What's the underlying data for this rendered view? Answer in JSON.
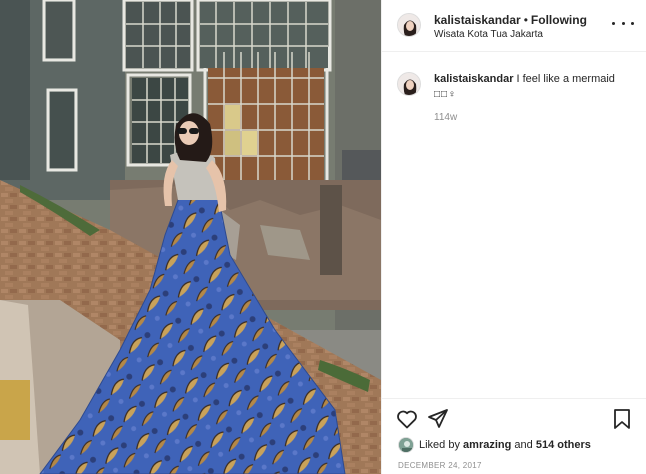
{
  "post": {
    "username": "kalistaiskandar",
    "separator": "•",
    "follow_label": "Following",
    "location": "Wisata Kota Tua Jakarta"
  },
  "caption": {
    "username": "kalistaiskandar",
    "text": "I feel like a mermaid",
    "emoji": "□□♀",
    "time": "114w"
  },
  "likes": {
    "prefix": "Liked by",
    "user": "amrazing",
    "connector": "and",
    "others": "514 others"
  },
  "date": "DECEMBER 24, 2017",
  "icons": {
    "more": "more-options-icon",
    "like": "heart-icon",
    "share": "share-icon",
    "save": "bookmark-icon"
  },
  "colors": {
    "text": "#262626",
    "muted": "#8e8e8e",
    "border": "#efefef"
  }
}
